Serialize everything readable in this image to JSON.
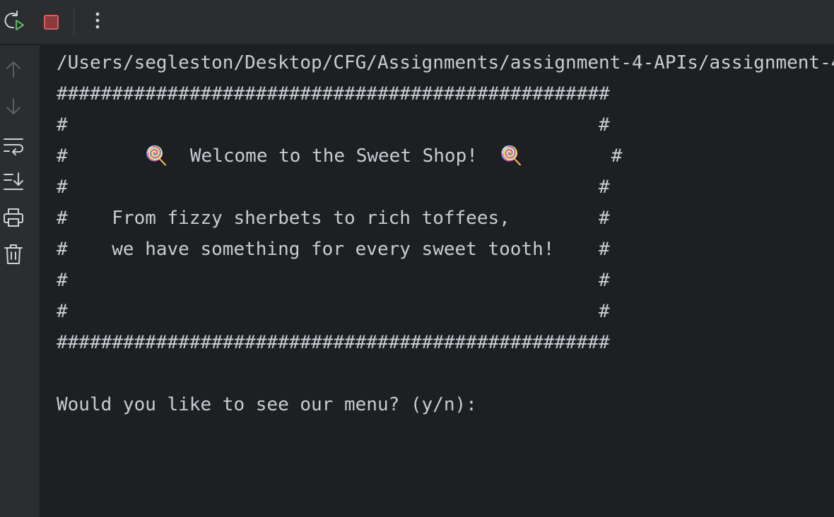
{
  "toolbar": {
    "icons": [
      "rerun-icon",
      "stop-icon",
      "more-vertical-icon"
    ],
    "colors": {
      "stop": "#db5c5c",
      "rerun_badge": "#5fb865"
    }
  },
  "side_toolbar": {
    "icons": [
      "arrow-up-icon",
      "arrow-down-icon",
      "soft-wrap-icon",
      "scroll-to-end-icon",
      "print-icon",
      "trash-icon"
    ]
  },
  "console": {
    "lines": [
      "/Users/segleston/Desktop/CFG/Assignments/assignment-4-APIs/assignment-4",
      "##################################################",
      "#                                                #",
      "#       🍭  Welcome to the Sweet Shop!  🍭        #",
      "#                                                #",
      "#    From fizzy sherbets to rich toffees,        #",
      "#    we have something for every sweet tooth!    #",
      "#                                                #",
      "#                                                #",
      "##################################################",
      "",
      "Would you like to see our menu? (y/n):"
    ]
  }
}
